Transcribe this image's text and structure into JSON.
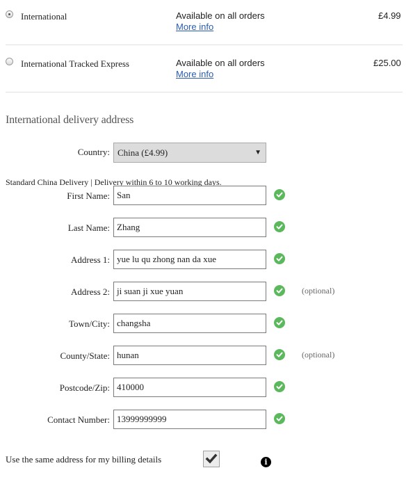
{
  "shipping_options": [
    {
      "name": "International",
      "availability": "Available on all orders",
      "more_info": "More info",
      "price": "£4.99",
      "selected": true
    },
    {
      "name": "International Tracked Express",
      "availability": "Available on all orders",
      "more_info": "More info",
      "price": "£25.00",
      "selected": false
    }
  ],
  "address": {
    "section_title": "International delivery address",
    "country_label": "Country:",
    "country_value": "China (£4.99)",
    "delivery_info": "Standard China Delivery | Delivery within 6 to 10 working days.",
    "fields": [
      {
        "label": "First Name:",
        "value": "San",
        "optional": ""
      },
      {
        "label": "Last Name:",
        "value": "Zhang",
        "optional": ""
      },
      {
        "label": "Address 1:",
        "value": "yue lu qu zhong nan da xue",
        "optional": ""
      },
      {
        "label": "Address 2:",
        "value": "ji suan ji xue yuan",
        "optional": "(optional)"
      },
      {
        "label": "Town/City:",
        "value": "changsha",
        "optional": ""
      },
      {
        "label": "County/State:",
        "value": "hunan",
        "optional": "(optional)"
      },
      {
        "label": "Postcode/Zip:",
        "value": "410000",
        "optional": ""
      },
      {
        "label": "Contact Number:",
        "value": "13999999999",
        "optional": ""
      }
    ],
    "billing_label": "Use the same address for my billing details",
    "billing_checked": true
  },
  "colors": {
    "link": "#2a5db0",
    "valid": "#5cb85c"
  }
}
